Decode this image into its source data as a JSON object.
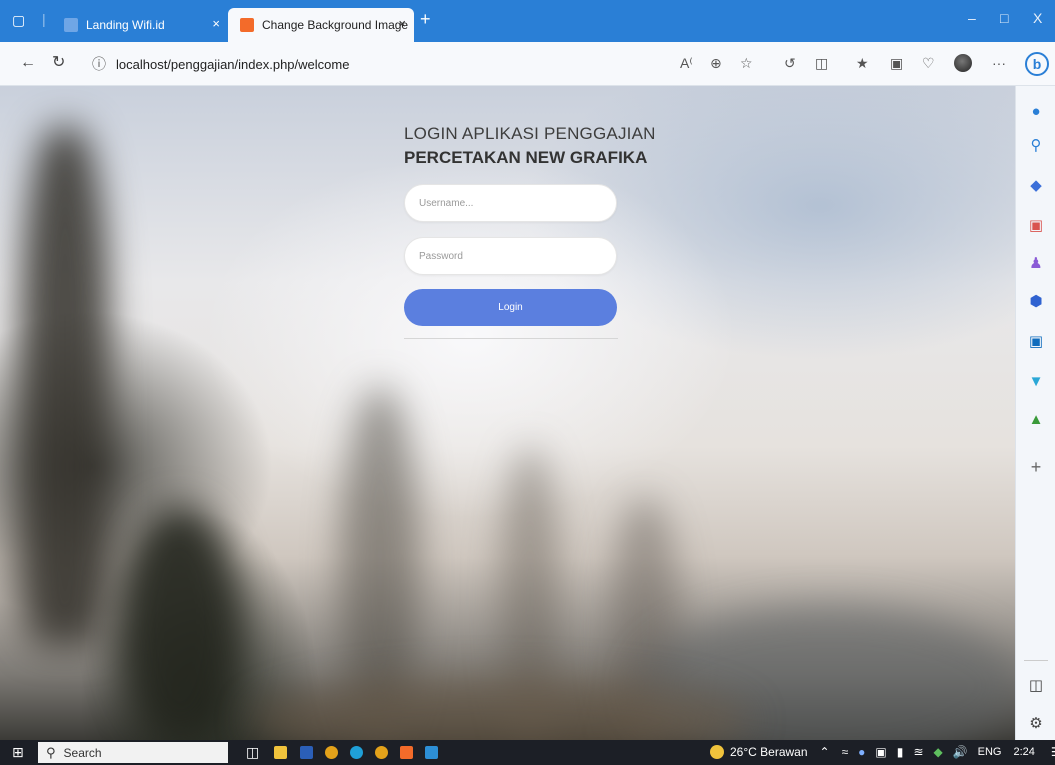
{
  "browser": {
    "tabs": [
      {
        "title": "Landing Wifi.id",
        "close": "×",
        "active": false
      },
      {
        "title": "Change Background Image",
        "close": "×",
        "active": true
      }
    ],
    "new_tab": "+",
    "window_controls": {
      "minimize": "–",
      "maximize": "□",
      "close": "X"
    },
    "url": "localhost/penggajian/index.php/welcome",
    "toolbar_more": "···"
  },
  "login": {
    "title_line1": "LOGIN APLIKASI PENGGAJIAN",
    "title_line2": "PERCETAKAN NEW GRAFIKA",
    "username_placeholder": "Username...",
    "password_placeholder": "Password",
    "login_label": "Login"
  },
  "taskbar": {
    "search_label": "Search",
    "weather": "26°C Berawan",
    "language": "ENG",
    "time": "2:24"
  },
  "colors": {
    "tabbar": "#2a7fd6",
    "login_button": "#5b7fdf",
    "taskbar": "#1c1f26"
  }
}
